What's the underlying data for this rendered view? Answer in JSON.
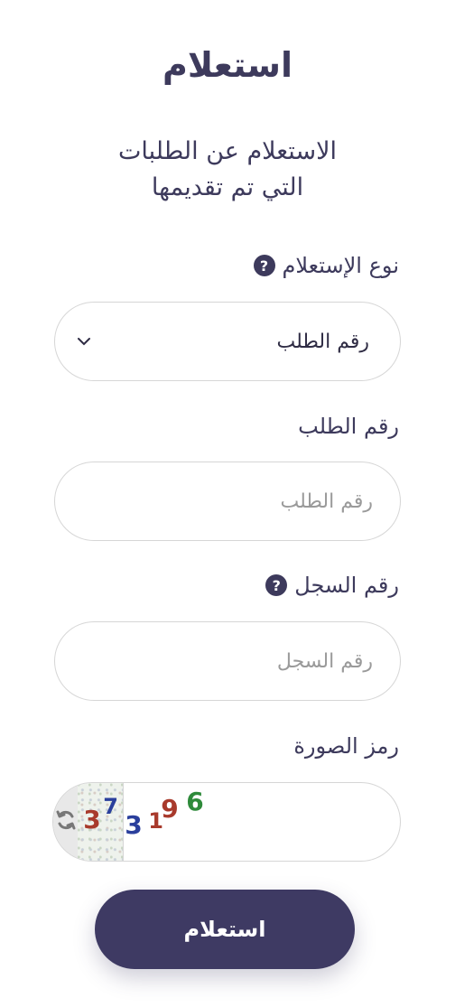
{
  "header": {
    "title": "استعلام",
    "subtitle_line1": "الاستعلام عن الطلبات",
    "subtitle_line2": "التي تم تقديمها"
  },
  "form": {
    "inquiry_type": {
      "label": "نوع الإستعلام",
      "help_icon": "question-circle-icon",
      "selected_value": "رقم الطلب"
    },
    "request_number": {
      "label": "رقم الطلب",
      "placeholder": "رقم الطلب",
      "value": ""
    },
    "registry_number": {
      "label": "رقم السجل",
      "help_icon": "question-circle-icon",
      "placeholder": "رقم السجل",
      "value": ""
    },
    "captcha": {
      "label": "رمز الصورة",
      "refresh_icon": "refresh-icon",
      "digits": [
        "3",
        "7",
        "3",
        "1",
        "9",
        "6"
      ],
      "value": ""
    },
    "submit_label": "استعلام"
  },
  "colors": {
    "primary": "#3e3a63",
    "text": "#3d3a5c",
    "border": "#d6d6d6",
    "placeholder": "#9a9a9a"
  }
}
